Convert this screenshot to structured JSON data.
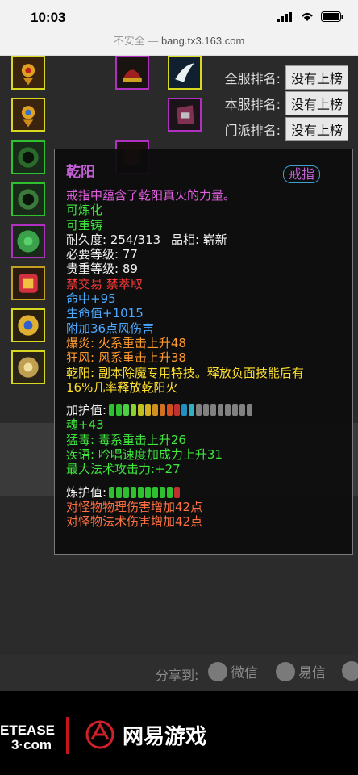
{
  "status": {
    "time": "10:03"
  },
  "browser": {
    "secure_label": "不安全 —",
    "url": "bang.tx3.163.com"
  },
  "ranks": [
    {
      "label": "全服排名:",
      "value": "没有上榜"
    },
    {
      "label": "本服排名:",
      "value": "没有上榜"
    },
    {
      "label": "门派排名:",
      "value": "没有上榜"
    }
  ],
  "tooltip": {
    "name": "乾阳",
    "type": "戒指",
    "desc": "戒指中蕴含了乾阳真火的力量。",
    "refinable": "可炼化",
    "recastable": "可重铸",
    "durability_label": "耐久度:",
    "durability": "254/313",
    "quality_label": "品相:",
    "quality": "崭新",
    "req_level_label": "必要等级:",
    "req_level": "77",
    "rare_level_label": "贵重等级:",
    "rare_level": "89",
    "restrict": "禁交易 禁萃取",
    "stats": [
      "命中+95",
      "生命值+1015",
      "附加36点风伤害"
    ],
    "bonus_1": "爆炎: 火系重击上升48",
    "bonus_2": "狂风: 风系重击上升38",
    "special": "乾阳: 副本除魔专用特技。释放负面技能后有",
    "special_2": "16%几率释放乾阳火",
    "protect_label": "加护值:",
    "protect_stats": [
      "魂+43",
      "猛毒: 毒系重击上升26",
      "疾语: 吟唱速度加成力上升31",
      "最大法术攻击力:+27"
    ],
    "refine_label": "炼护值:",
    "refine_stats": [
      "对怪物物理伤害增加42点",
      "对怪物法术伤害增加42点"
    ]
  },
  "share": {
    "label": "分享到:",
    "wechat": "微信",
    "yixin": "易信"
  },
  "footer": {
    "netease_1": "ETEASE",
    "netease_2": "3·com",
    "game": "网易游戏"
  },
  "colors": {
    "accent_purple": "#c45fd8",
    "slot_yellow": "#d8d820",
    "slot_green": "#2ec02e"
  }
}
